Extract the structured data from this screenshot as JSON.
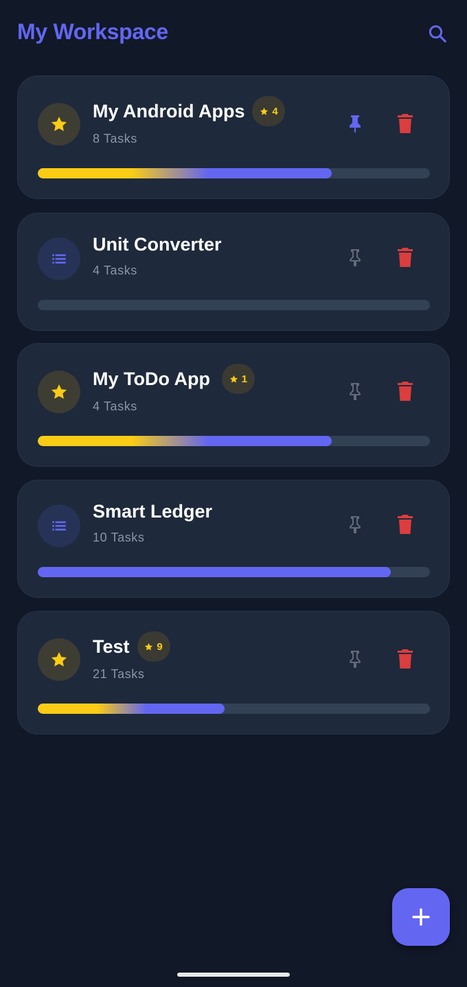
{
  "app": {
    "title": "My Workspace",
    "search_icon": "search-icon",
    "add_icon": "plus-icon"
  },
  "colors": {
    "background": "#111827",
    "card": "#1e293b",
    "accent": "#6366f1",
    "star": "#facc15",
    "delete": "#dc3d3d",
    "pin_inactive": "#6b7280",
    "track": "#334155"
  },
  "projects": [
    {
      "title": "My Android Apps",
      "tasks_label": "8 Tasks",
      "starred": true,
      "star_count": "4",
      "pinned": true,
      "progress": 0.75,
      "icon": "star-icon"
    },
    {
      "title": "Unit Converter",
      "tasks_label": "4 Tasks",
      "starred": false,
      "star_count": "",
      "pinned": false,
      "progress": 0,
      "icon": "list-icon"
    },
    {
      "title": "My ToDo App",
      "tasks_label": "4 Tasks",
      "starred": true,
      "star_count": "1",
      "pinned": false,
      "progress": 0.75,
      "icon": "star-icon"
    },
    {
      "title": "Smart Ledger",
      "tasks_label": "10 Tasks",
      "starred": false,
      "star_count": "",
      "pinned": false,
      "progress": 0.9,
      "icon": "list-icon"
    },
    {
      "title": "Test",
      "tasks_label": "21 Tasks",
      "starred": true,
      "star_count": "9",
      "pinned": false,
      "progress": 0.476,
      "icon": "star-icon"
    }
  ]
}
